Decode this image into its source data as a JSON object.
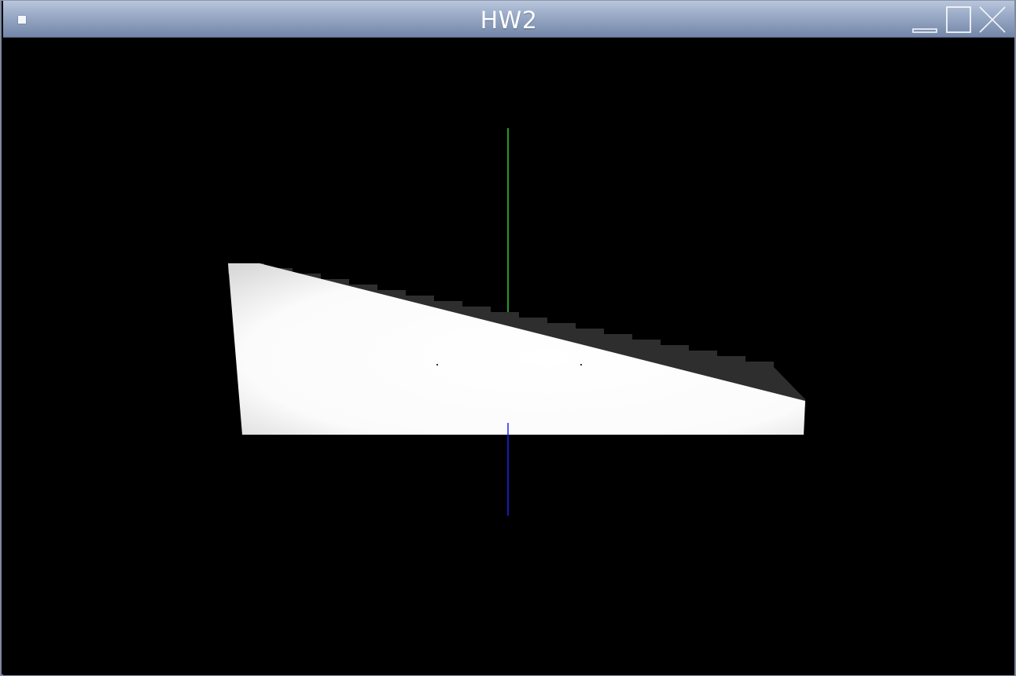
{
  "window": {
    "title": "HW2"
  },
  "controls": {
    "menu_icon": "window-menu-icon",
    "minimize_icon": "minimize-icon",
    "maximize_icon": "maximize-icon",
    "close_icon": "close-icon"
  },
  "viewport": {
    "background_color": "#000000",
    "shape_color": "#ffffff",
    "axes": {
      "y_axis_color": "#33cc33",
      "z_axis_color": "#2222ee"
    }
  }
}
